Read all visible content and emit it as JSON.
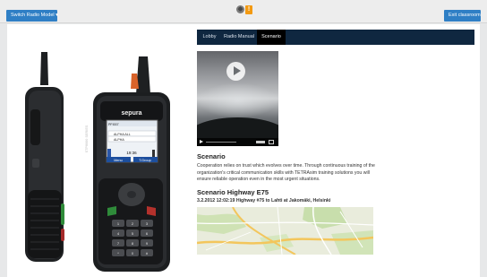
{
  "header": {
    "switch_label": "Switch Radio Model",
    "switch_caret": "▾",
    "exit_label": "Exit classroom",
    "warning_glyph": "!"
  },
  "tabs": [
    {
      "label": "Lobby"
    },
    {
      "label": "Radio Manual"
    },
    {
      "label": "Scenario"
    }
  ],
  "radio": {
    "brand": "sepura",
    "side_label": "STP8000 SERIES",
    "screen_line1": "PFI007",
    "screen_row1": "ALPHA ALL",
    "screen_row2": "ALPHA",
    "screen_time": "19:36",
    "softkey_left": "Menu",
    "softkey_right": "T.Group",
    "keys": [
      "1",
      "2",
      "3",
      "4",
      "5",
      "6",
      "7",
      "8",
      "9",
      "*",
      "0",
      "#"
    ]
  },
  "content": {
    "scenario_heading": "Scenario",
    "scenario_text": "Cooperation relies on trust which evolves over time. Through continuous training of the organization's critical communication skills with TETRAsim training solutions you will ensure reliable operation even in the most urgent situations.",
    "highway_heading": "Scenario Highway E75",
    "highway_subtitle": "3.2.2012 12:02:19 Highway #75 to Lahti at Jakomäki, Helsinki"
  },
  "icons": {
    "play": "play-icon",
    "settings": "settings-dot-icon",
    "warning": "warning-icon"
  },
  "colors": {
    "accent": "#2f7fc5",
    "tab_bar": "#0f2740",
    "active_tab": "#000000",
    "warning": "#f39a12",
    "map_road": "#f3c65c"
  }
}
